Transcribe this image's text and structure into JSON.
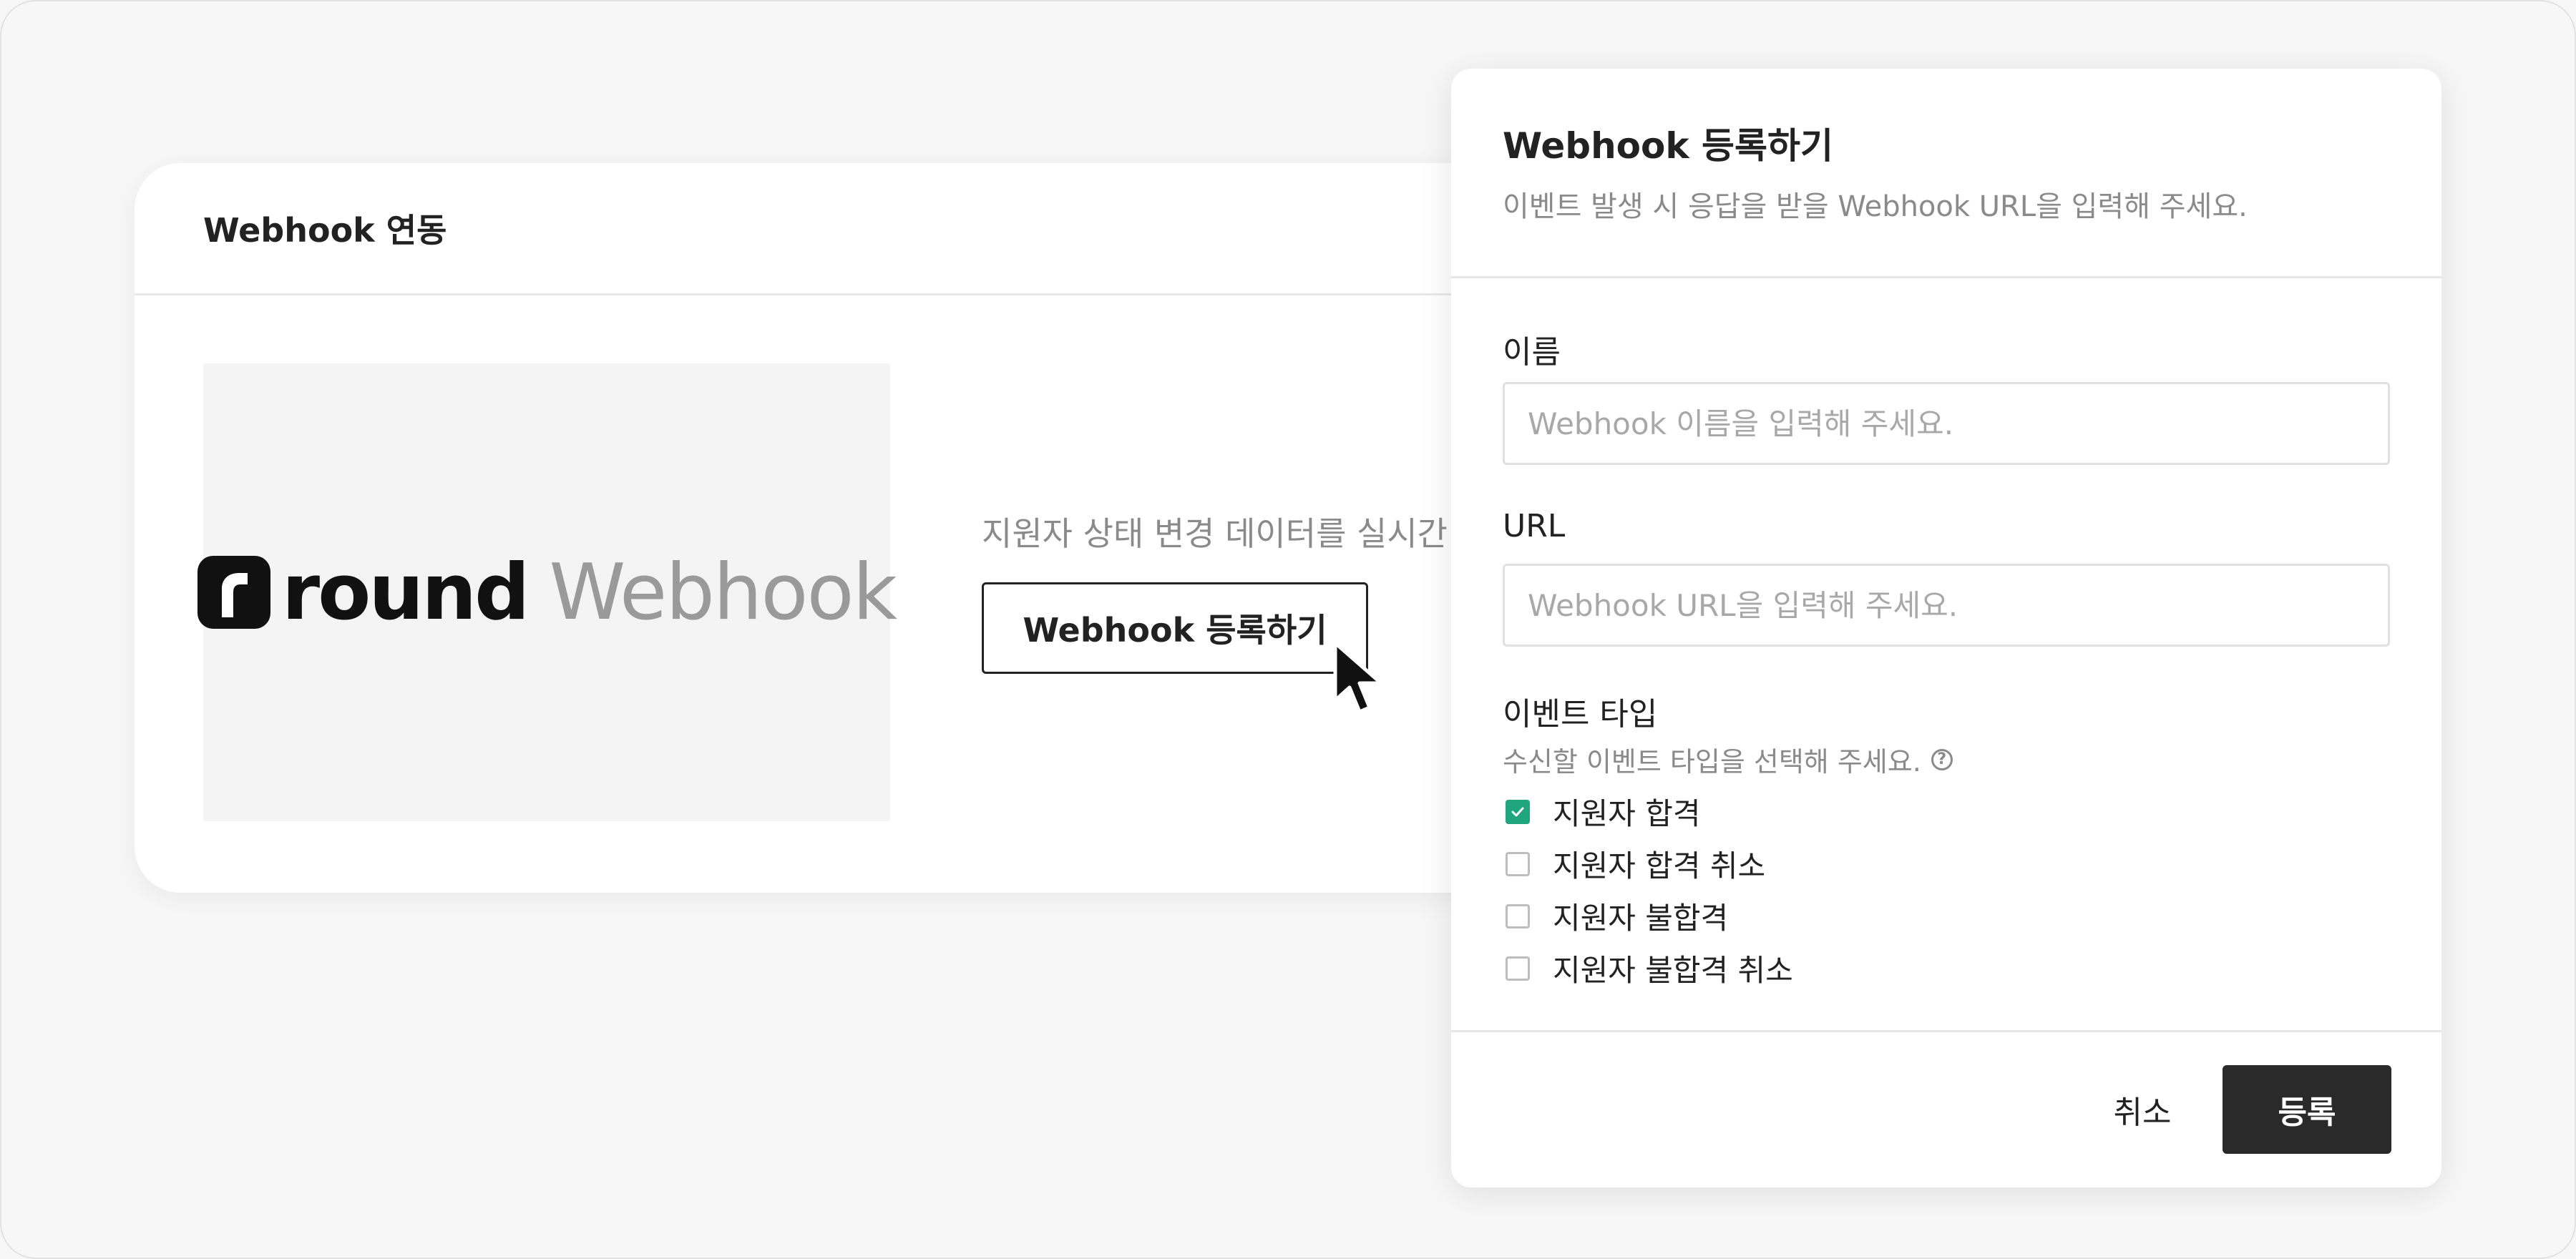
{
  "card": {
    "title": "Webhook 연동",
    "logo_round": "round",
    "logo_webhook": "Webhook",
    "description": "지원자 상태 변경 데이터를 실시간",
    "register_button": "Webhook 등록하기"
  },
  "modal": {
    "title": "Webhook 등록하기",
    "subtitle": "이벤트 발생 시 응답을 받을 Webhook URL을 입력해 주세요.",
    "name_label": "이름",
    "name_placeholder": "Webhook 이름을 입력해 주세요.",
    "url_label": "URL",
    "url_placeholder": "Webhook URL을 입력해 주세요.",
    "event_label": "이벤트 타입",
    "event_hint": "수신할 이벤트 타입을 선택해 주세요.",
    "options": [
      {
        "label": "지원자 합격",
        "checked": true
      },
      {
        "label": "지원자 합격 취소",
        "checked": false
      },
      {
        "label": "지원자 불합격",
        "checked": false
      },
      {
        "label": "지원자 불합격 취소",
        "checked": false
      }
    ],
    "cancel": "취소",
    "submit": "등록"
  },
  "colors": {
    "accent": "#1fa67e",
    "primary_button": "#2a2a2a"
  },
  "icons": {
    "logo": "round-logo-icon",
    "help": "help-icon",
    "check": "check-icon",
    "cursor": "cursor-icon"
  }
}
